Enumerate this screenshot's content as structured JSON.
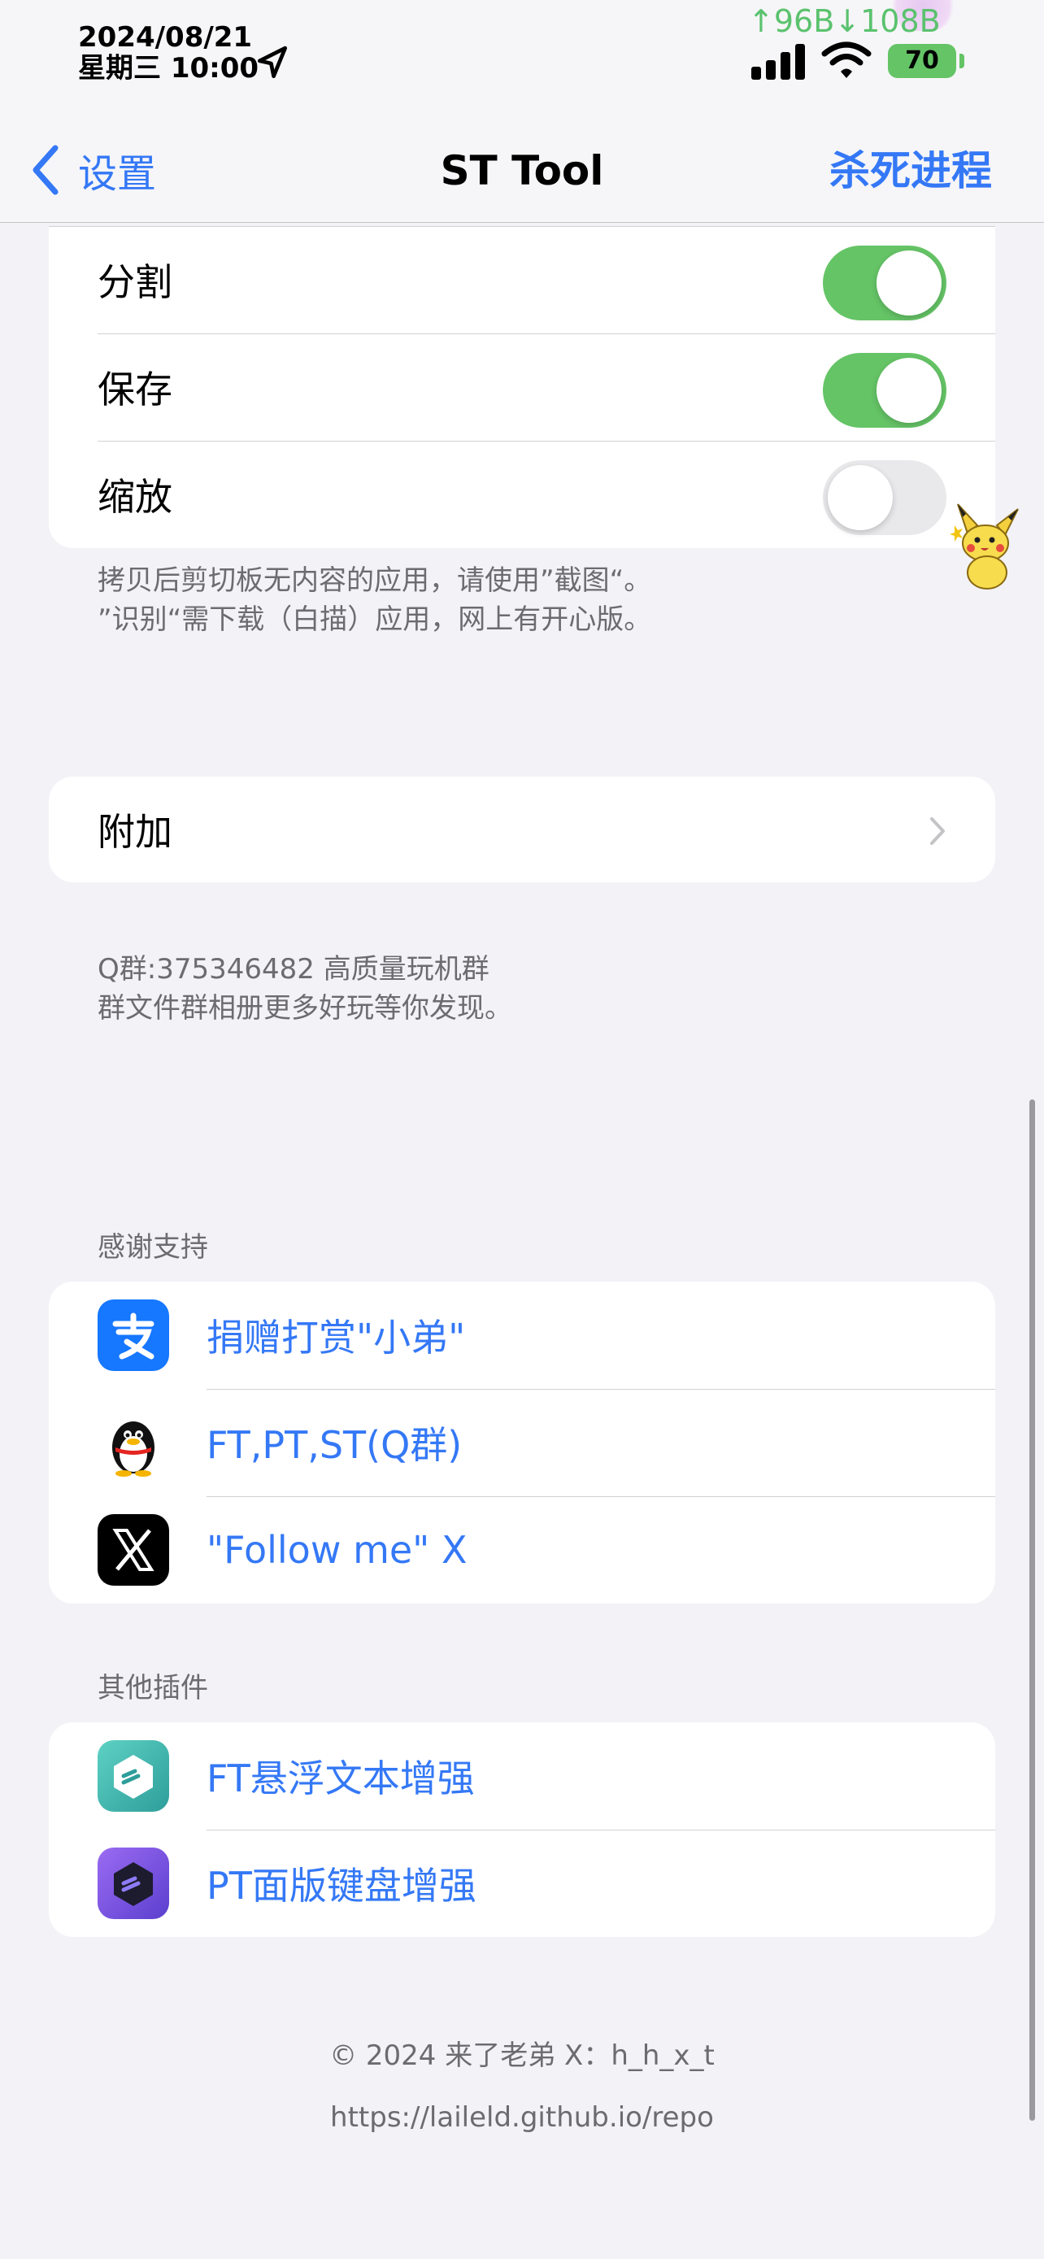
{
  "status_bar": {
    "date": "2024/08/21",
    "day_time": "星期三 10:00",
    "net_speed": "↑96B↓108B",
    "battery": "70"
  },
  "nav": {
    "back_label": "设置",
    "title": "ST Tool",
    "action_label": "杀死进程"
  },
  "toggles_section": {
    "rows": [
      {
        "label": "分割",
        "on": true
      },
      {
        "label": "保存",
        "on": true
      },
      {
        "label": "缩放",
        "on": false
      }
    ],
    "footer_line1": "拷贝后剪切板无内容的应用，请使用”截图“。",
    "footer_line2": "”识别“需下载（白描）应用，网上有开心版。"
  },
  "extra_section": {
    "row_label": "附加",
    "footer_line1": "Q群:375346482 高质量玩机群",
    "footer_line2": "群文件群相册更多好玩等你发现。"
  },
  "thanks_section": {
    "header": "感谢支持",
    "links": [
      {
        "label": "捐赠打赏\"小弟\"",
        "icon": "alipay-icon"
      },
      {
        "label": "FT,PT,ST(Q群)",
        "icon": "qq-penguin-icon"
      },
      {
        "label": "\"Follow me\" X",
        "icon": "x-logo-icon"
      }
    ]
  },
  "plugins_section": {
    "header": "其他插件",
    "links": [
      {
        "label": "FT悬浮文本增强",
        "icon": "ft-plugin-icon"
      },
      {
        "label": "PT面版键盘增强",
        "icon": "pt-plugin-icon"
      }
    ]
  },
  "footer": {
    "copyright": "© 2024  来了老弟  X：h_h_x_t",
    "repo": "https://laileld.github.io/repo"
  },
  "colors": {
    "accent": "#3478F6",
    "toggle_on": "#65C466",
    "background": "#F2F2F7"
  }
}
